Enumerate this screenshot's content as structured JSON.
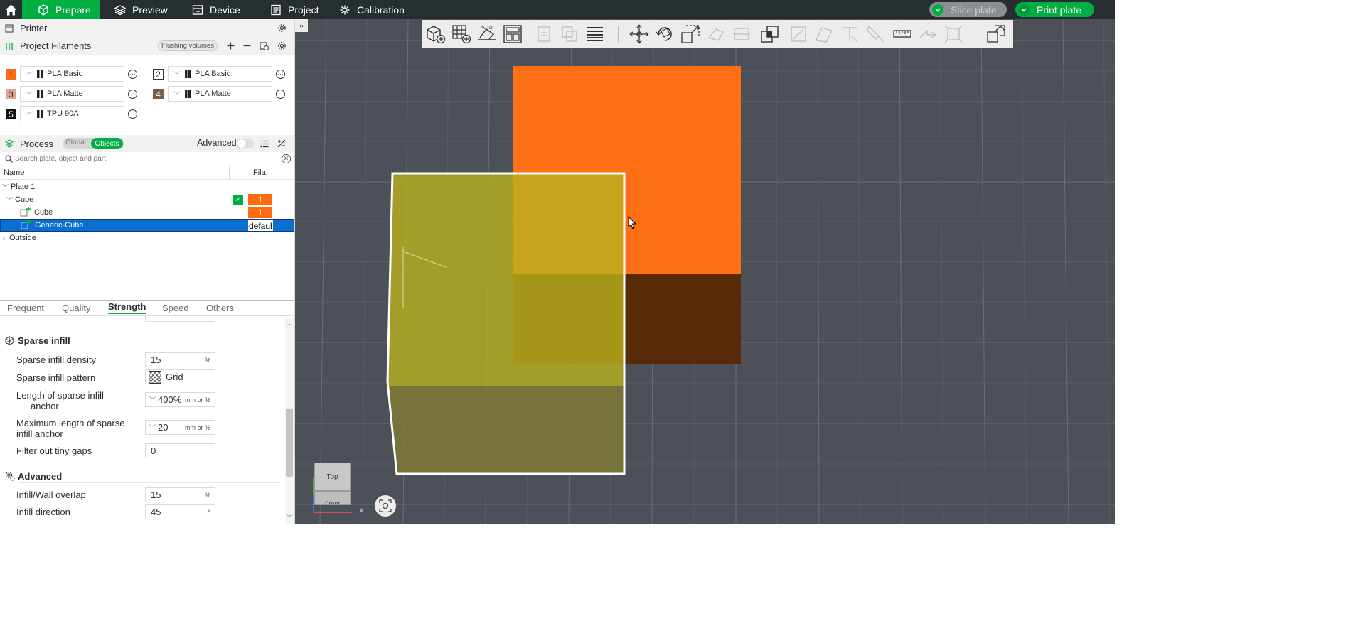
{
  "nav": {
    "tabs": [
      {
        "label": "Prepare",
        "icon": "cube-icon"
      },
      {
        "label": "Preview",
        "icon": "layers-icon"
      },
      {
        "label": "Device",
        "icon": "device-icon"
      },
      {
        "label": "Project",
        "icon": "project-icon"
      },
      {
        "label": "Calibration",
        "icon": "calibration-icon"
      }
    ],
    "slice_label": "Slice plate",
    "print_label": "Print plate"
  },
  "printer": {
    "label": "Printer"
  },
  "filaments": {
    "label": "Project Filaments",
    "flushing_label": "Flushing volumes",
    "items": [
      {
        "num": "1",
        "name": "PLA Basic",
        "color": "#ff6b10"
      },
      {
        "num": "2",
        "name": "PLA Basic",
        "color": "#ffffff"
      },
      {
        "num": "3",
        "name": "PLA Matte",
        "color": "#d9a58c"
      },
      {
        "num": "4",
        "name": "PLA Matte",
        "color": "#7b5c46"
      },
      {
        "num": "5",
        "name": "TPU 90A",
        "color": "#111111"
      }
    ]
  },
  "process": {
    "label": "Process",
    "toggle_global": "Global",
    "toggle_objects": "Objects",
    "advanced_label": "Advanced"
  },
  "search": {
    "placeholder": "Search plate, object and part."
  },
  "tree": {
    "col_name": "Name",
    "col_fila": "Fila.",
    "plate": "Plate 1",
    "object": "Cube",
    "object_fila": "1",
    "part": "Cube",
    "part_fila": "1",
    "modifier": "Generic-Cube",
    "modifier_fila": "defaul",
    "outside": "Outside"
  },
  "settings_tabs": [
    "Frequent",
    "Quality",
    "Strength",
    "Speed",
    "Others"
  ],
  "sparse": {
    "title": "Sparse infill",
    "density_label": "Sparse infill density",
    "density_value": "15",
    "density_unit": "%",
    "pattern_label": "Sparse infill pattern",
    "pattern_value": "Grid",
    "anchor_label_1": "Length of sparse infill",
    "anchor_label_2": "anchor",
    "anchor_value": "400%",
    "anchor_unit": "mm or %",
    "max_anchor_label_1": "Maximum length of sparse",
    "max_anchor_label_2": "infill anchor",
    "max_anchor_value": "20",
    "max_anchor_unit": "mm or %",
    "gaps_label": "Filter out tiny gaps",
    "gaps_value": "0"
  },
  "advanced": {
    "title": "Advanced",
    "overlap_label": "Infill/Wall overlap",
    "overlap_value": "15",
    "overlap_unit": "%",
    "direction_label": "Infill direction",
    "direction_value": "45",
    "direction_unit": "°"
  },
  "viewport": {
    "cube_top": "Top",
    "cube_front": "Front",
    "axis_x": "x"
  },
  "colors": {
    "accent": "#00ae42",
    "orange": "#ff6b10",
    "selection": "#0c6fcf"
  }
}
